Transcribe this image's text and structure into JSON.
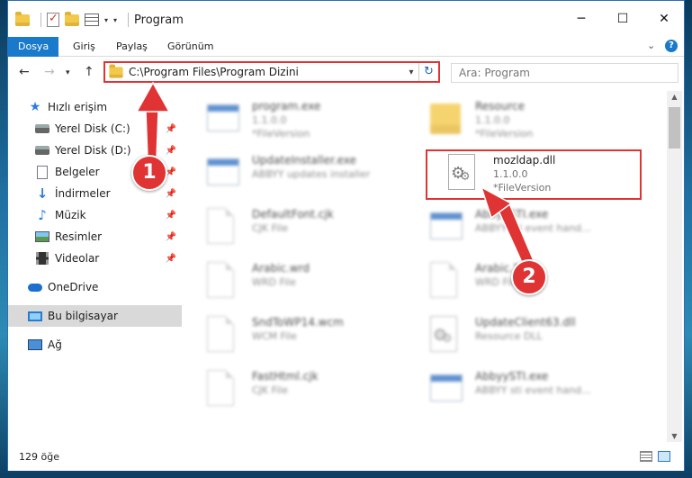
{
  "window": {
    "title": "Program",
    "controls": {
      "minimize": "─",
      "maximize": "☐",
      "close": "✕"
    }
  },
  "ribbon": {
    "tabs": [
      "Dosya",
      "Giriş",
      "Paylaş",
      "Görünüm"
    ],
    "active_tab": "Dosya",
    "help": "?"
  },
  "nav": {
    "back": "←",
    "forward": "→",
    "dropdown": "▾",
    "up": "↑",
    "address": "C:\\Program Files\\Program Dizini",
    "address_dropdown": "▾",
    "refresh": "↻",
    "search_placeholder": "Ara: Program"
  },
  "navpane": {
    "items": [
      {
        "label": "Hızlı erişim",
        "icon": "star-icon",
        "pinned": false
      },
      {
        "label": "Yerel Disk (C:)",
        "icon": "drive-icon",
        "pinned": true
      },
      {
        "label": "Yerel Disk (D:)",
        "icon": "drive-icon",
        "pinned": true
      },
      {
        "label": "Belgeler",
        "icon": "document-icon",
        "pinned": true
      },
      {
        "label": "İndirmeler",
        "icon": "download-icon",
        "pinned": true
      },
      {
        "label": "Müzik",
        "icon": "music-icon",
        "pinned": true
      },
      {
        "label": "Resimler",
        "icon": "pictures-icon",
        "pinned": true
      },
      {
        "label": "Videolar",
        "icon": "video-icon",
        "pinned": true
      },
      {
        "label": "OneDrive",
        "icon": "cloud-icon",
        "pinned": false
      },
      {
        "label": "Bu bilgisayar",
        "icon": "computer-icon",
        "pinned": false
      },
      {
        "label": "Ağ",
        "icon": "network-icon",
        "pinned": false
      }
    ],
    "pin_glyph": "📌",
    "selected": "Bu bilgisayar"
  },
  "files": [
    {
      "name": "program.exe",
      "line1": "1.1.0.0",
      "line2": "*FileVersion",
      "icon": "app-icon"
    },
    {
      "name": "Resource",
      "line1": "1.1.0.0",
      "line2": "*FileVersion",
      "icon": "folder-icon"
    },
    {
      "name": "UpdateInstaller.exe",
      "line1": "ABBYY updates installer",
      "line2": "",
      "icon": "app-icon"
    },
    {
      "name": "mozldap.dll",
      "line1": "1.1.0.0",
      "line2": "*FileVersion",
      "icon": "dll-gear-icon"
    },
    {
      "name": "DefaultFont.cjk",
      "line1": "CJK File",
      "line2": "",
      "icon": "blank-file-icon"
    },
    {
      "name": "AbbyySTI.exe",
      "line1": "ABBYY sti event hand...",
      "line2": "",
      "icon": "app-icon"
    },
    {
      "name": "Arabic.wrd",
      "line1": "WRD File",
      "line2": "",
      "icon": "blank-file-icon"
    },
    {
      "name": "Arabic.?",
      "line1": "WRD File",
      "line2": "",
      "icon": "blank-file-icon"
    },
    {
      "name": "SndToWP14.wcm",
      "line1": "WCM File",
      "line2": "",
      "icon": "blank-file-icon"
    },
    {
      "name": "UpdateClient63.dll",
      "line1": "Resource DLL",
      "line2": "",
      "icon": "dll-gear-icon"
    },
    {
      "name": "FastHtml.cjk",
      "line1": "CJK File",
      "line2": "",
      "icon": "blank-file-icon"
    },
    {
      "name": "AbbyySTI.exe",
      "line1": "ABBYY sti event hand...",
      "line2": "",
      "icon": "app-icon"
    }
  ],
  "status": {
    "count": "129 öğe"
  },
  "annotations": {
    "badge1": "1",
    "badge2": "2"
  },
  "colors": {
    "accent": "#1979ca",
    "highlight": "#e03434"
  }
}
